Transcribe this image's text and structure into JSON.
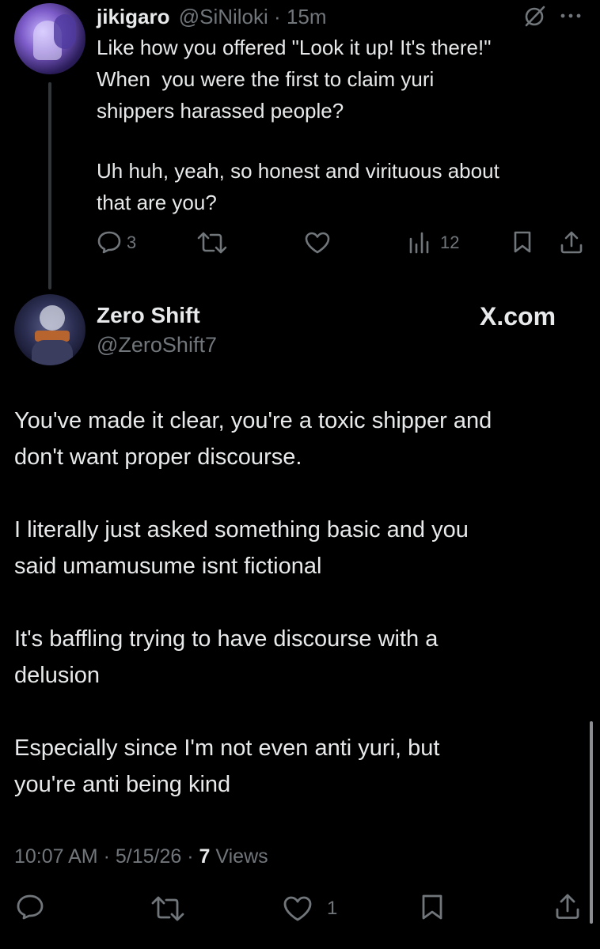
{
  "reply_tweet": {
    "display_name": "jikigaro",
    "handle": "@SiNiloki",
    "separator": "·",
    "time": "15m",
    "text_lines": [
      "Like how you offered \"Look it up! It's there!\"",
      "When  you were the first to claim yuri",
      "shippers harassed people?",
      "",
      "Uh huh, yeah, so honest and virituous about",
      "that are you?"
    ],
    "reply_count": "3",
    "views_count": "12",
    "icons": [
      "grok-icon",
      "more-icon",
      "reply-icon",
      "repost-icon",
      "like-icon",
      "views-icon",
      "bookmark-icon",
      "share-icon"
    ]
  },
  "main_tweet": {
    "display_name": "Zero Shift",
    "handle": "@ZeroShift7",
    "badge": "X.com",
    "paragraphs": [
      [
        "You've made it clear, you're a toxic shipper and",
        "don't want proper discourse."
      ],
      [
        "I literally just asked something basic and you",
        "said umamusume isnt fictional"
      ],
      [
        "It's baffling trying to have discourse with a",
        "delusion"
      ],
      [
        "Especially since I'm not even anti yuri, but",
        "you're anti being kind"
      ]
    ],
    "time": "10:07 AM",
    "sep1": "·",
    "date": "5/15/26",
    "sep2": "·",
    "views_count": "7",
    "views_label": "Views",
    "like_count": "1"
  },
  "colors": {
    "background": "#000000",
    "text": "#e7e9ea",
    "muted": "#71767b"
  }
}
